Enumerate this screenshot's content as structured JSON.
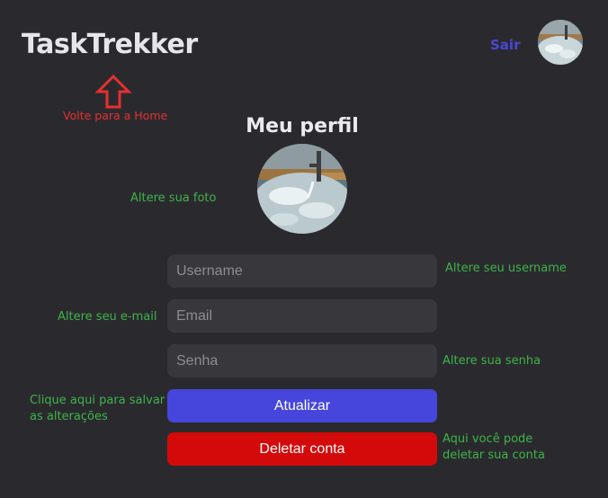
{
  "header": {
    "logo": "TaskTrekker",
    "logout_label": "Sair"
  },
  "profile": {
    "title": "Meu perfil"
  },
  "form": {
    "username_placeholder": "Username",
    "email_placeholder": "Email",
    "password_placeholder": "Senha",
    "update_label": "Atualizar",
    "delete_label": "Deletar conta"
  },
  "annotations": {
    "home": "Volte para a Home",
    "photo": "Altere sua foto",
    "username": "Altere seu username",
    "email": "Altere seu e-mail",
    "password": "Altere sua senha",
    "save_line1": "Clique aqui para salvar",
    "save_line2": "as alterações",
    "delete_line1": "Aqui você pode",
    "delete_line2": "deletar sua conta"
  },
  "colors": {
    "background": "#2a2a2e",
    "accent_blue": "#4646dc",
    "danger_red": "#d40a0a",
    "annotation_green": "#3fb24a",
    "annotation_red": "#e53030"
  },
  "icons": {
    "home_arrow": "arrow-up-outline-icon"
  }
}
